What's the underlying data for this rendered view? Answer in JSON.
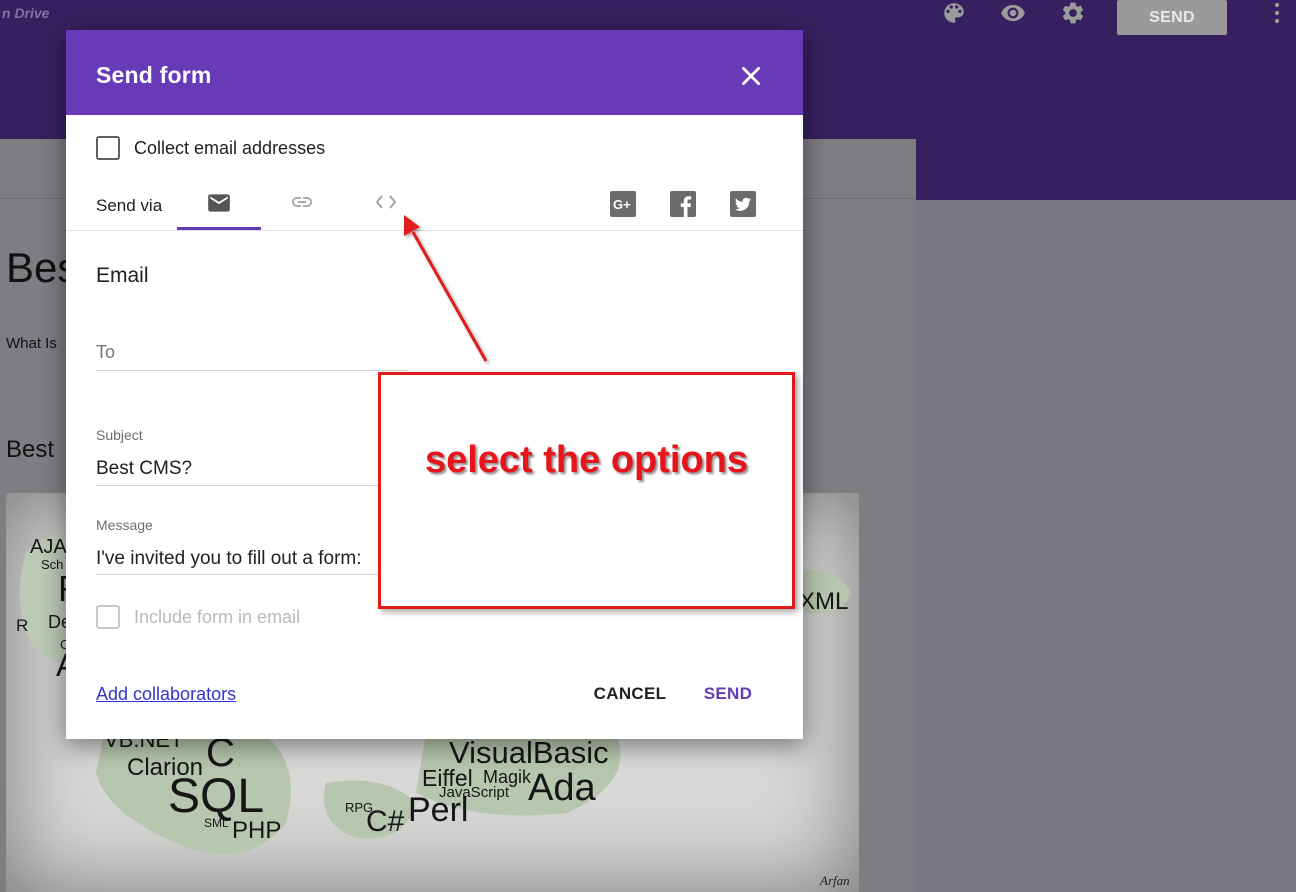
{
  "app": {
    "drive_label": "n Drive",
    "send_button": "SEND"
  },
  "form_background": {
    "title_fragment": "Bes",
    "description_fragment": "What Is",
    "question_fragment": "Best "
  },
  "wordcloud": {
    "words": [
      "AJA",
      "Sch",
      "R",
      "De",
      "R",
      "A",
      "C",
      "XML",
      "VB.NET",
      "C",
      "Clarion",
      "SQL",
      "SML",
      "PHP",
      "VisualBasic",
      "Eiffel",
      "Magik",
      "JavaScript",
      "Ada",
      "RPG",
      "C#",
      "Perl"
    ],
    "signature": "Arfan"
  },
  "dialog": {
    "title": "Send form",
    "collect_email_label": "Collect email addresses",
    "send_via_label": "Send via",
    "active_tab": "email",
    "section_title": "Email",
    "to_placeholder": "To",
    "subject_label": "Subject",
    "subject_value": "Best CMS?",
    "message_label": "Message",
    "message_value": "I've invited you to fill out a form:",
    "include_form_label": "Include form in email",
    "add_collaborators": "Add collaborators",
    "cancel": "CANCEL",
    "send": "SEND"
  },
  "annotation": {
    "callout_text": "select the options"
  },
  "colors": {
    "brand_purple": "#673ab7",
    "header_dark_purple": "#36205f",
    "annotation_red": "#e11b1b",
    "link_blue": "#3333cc"
  },
  "icons": [
    "palette-icon",
    "eye-icon",
    "gear-icon",
    "more-vert-icon",
    "close-icon",
    "email-icon",
    "link-icon",
    "embed-code-icon",
    "google-plus-icon",
    "facebook-icon",
    "twitter-icon"
  ]
}
